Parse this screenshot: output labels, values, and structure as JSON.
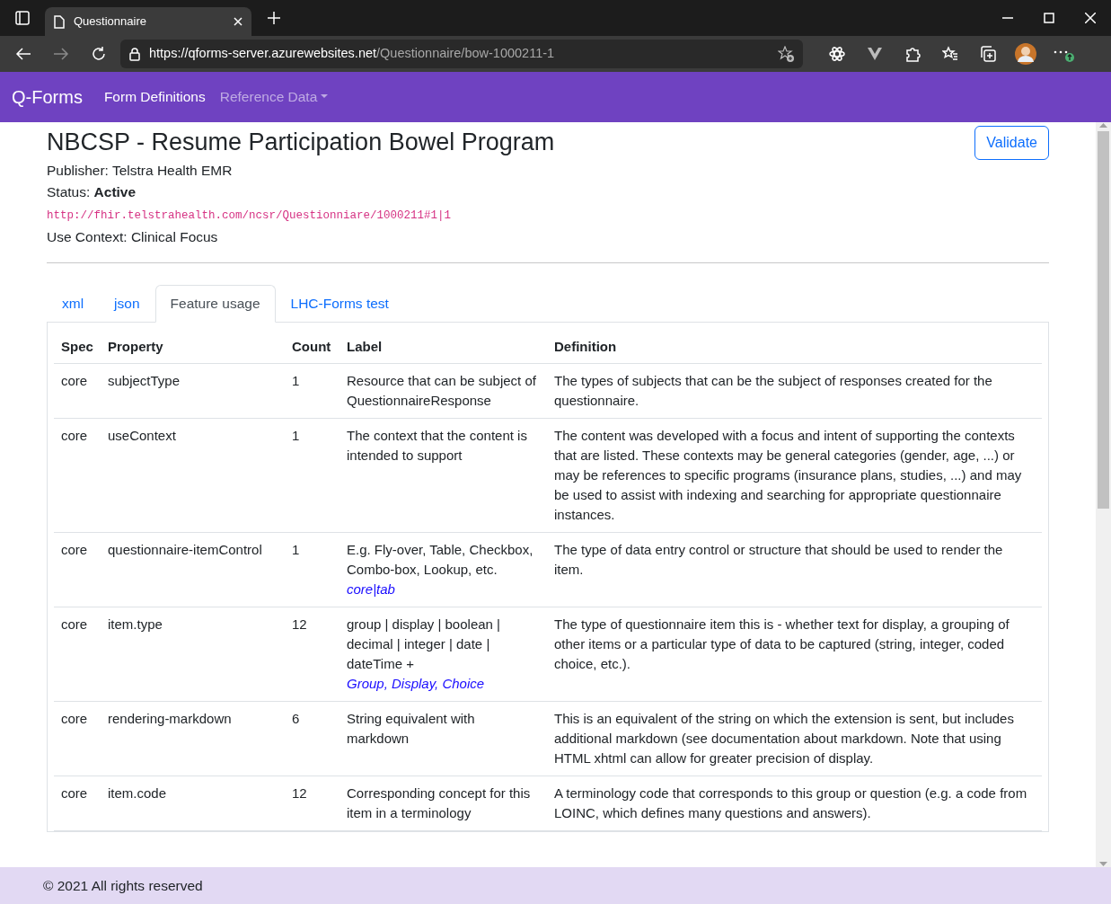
{
  "browser": {
    "tab_title": "Questionnaire",
    "url": {
      "scheme": "https://",
      "host": "qforms-server.azurewebsites.net",
      "path": "/Questionnaire/bow-1000211-1"
    }
  },
  "navbar": {
    "brand": "Q-Forms",
    "items": [
      {
        "label": "Form Definitions",
        "active": true,
        "dropdown": false
      },
      {
        "label": "Reference Data",
        "active": false,
        "dropdown": true
      }
    ]
  },
  "header": {
    "title": "NBCSP - Resume Participation Bowel Program",
    "validate_button": "Validate",
    "publisher": "Publisher: Telstra Health EMR",
    "status": "Status: **Active**",
    "canonical_url": "http://fhir.telstrahealth.com/ncsr/Questionniare/1000211#1|1",
    "use_context": "Use Context: Clinical Focus"
  },
  "tabs": [
    {
      "label": "xml",
      "selected": false
    },
    {
      "label": "json",
      "selected": false
    },
    {
      "label": "Feature usage",
      "selected": true
    },
    {
      "label": "LHC-Forms test",
      "selected": false
    }
  ],
  "table": {
    "columns": [
      "Spec",
      "Property",
      "Count",
      "Label",
      "Definition"
    ],
    "rows": [
      {
        "spec": "core",
        "property": "subjectType",
        "count": "1",
        "label": "Resource that can be subject of QuestionnaireResponse",
        "definition": "The types of subjects that can be the subject of responses created for the questionnaire."
      },
      {
        "spec": "core",
        "property": "useContext",
        "count": "1",
        "label": "The context that the content is intended to support",
        "definition": "The content was developed with a focus and intent of supporting the contexts that are listed. These contexts may be general categories (gender, age, ...) or may be references to specific programs (insurance plans, studies, ...) and may be used to assist with indexing and searching for appropriate questionnaire instances."
      },
      {
        "spec": "core",
        "property": "questionnaire-itemControl",
        "count": "1",
        "label": "E.g. Fly-over, Table, Checkbox, Combo-box, Lookup, etc.",
        "label_link": "core|tab",
        "definition": "The type of data entry control or structure that should be used to render the item."
      },
      {
        "spec": "core",
        "property": "item.type",
        "count": "12",
        "label": "group | display | boolean | decimal | integer | date | dateTime +",
        "label_link": "Group, Display, Choice",
        "definition": "The type of questionnaire item this is - whether text for display, a grouping of other items or a particular type of data to be captured (string, integer, coded choice, etc.)."
      },
      {
        "spec": "core",
        "property": "rendering-markdown",
        "count": "6",
        "label": "String equivalent with markdown",
        "definition": "This is an equivalent of the string on which the extension is sent, but includes additional markdown (see documentation about markdown. Note that using HTML xhtml can allow for greater precision of display."
      },
      {
        "spec": "core",
        "property": "item.code",
        "count": "12",
        "label": "Corresponding concept for this item in a terminology",
        "definition": "A terminology code that corresponds to this group or question (e.g. a code from LOINC, which defines many questions and answers)."
      }
    ]
  },
  "footer": {
    "text": "© 2021 All rights reserved"
  }
}
